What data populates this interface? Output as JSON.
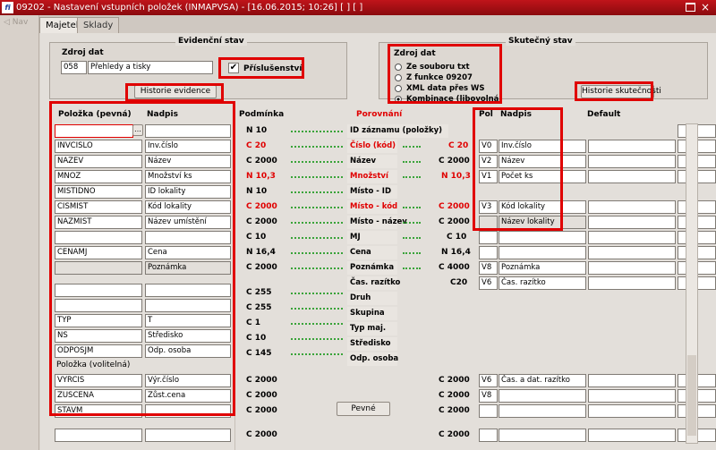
{
  "window": {
    "icon_text": "fi",
    "title": "09202 - Nastavení vstupních položek (INMAPVSA) - [16.06.2015; 10:26] [ ] [ ]",
    "close_glyph": "×"
  },
  "nav": {
    "label": "◁ Nav"
  },
  "tabs": [
    "Majetek",
    "Sklady"
  ],
  "evidencni": {
    "title": "Evidenční stav",
    "zdroj_label": "Zdroj dat",
    "zdroj_code": "058",
    "zdroj_name": "Přehledy a tisky",
    "prislusenstvi_check": "✔",
    "prislusenstvi_label": "Příslušenství",
    "historie_btn": "Historie evidence"
  },
  "skutecny": {
    "title": "Skutečný stav",
    "zdroj_label": "Zdroj dat",
    "radio_options": [
      "Ze souboru txt",
      "Z funkce 09207",
      "XML data přes WS",
      "Kombinace (libovolná)"
    ],
    "historie_btn": "Historie skutečnosti"
  },
  "headers": {
    "polozka": "Položka  (pevná)",
    "nadpis": "Nadpis",
    "podminka": "Podmínka",
    "porovnani": "Porovnání",
    "pol": "Pol",
    "nadpis_r": "Nadpis",
    "default": "Default",
    "polozka_volitelna": "Položka   (volitelná)"
  },
  "ellipsis": "…",
  "button_pevne": "Pevné",
  "rows": [
    {
      "item": "",
      "title": "",
      "cond": "N 10",
      "cmp": "ID záznamu (položky)",
      "rcond": "",
      "pol": "",
      "rtitle": ""
    },
    {
      "item": "INVCISLO",
      "title": "Inv.číslo",
      "cond": "C 20",
      "cmp": "Číslo (kód)",
      "rcond": "C 20",
      "pol": "V0",
      "rtitle": "Inv.číslo"
    },
    {
      "item": "NAZEV",
      "title": "Název",
      "cond": "C 2000",
      "cmp": "Název",
      "rcond": "C 2000",
      "pol": "V2",
      "rtitle": "Název"
    },
    {
      "item": "MNOZ",
      "title": "Množství ks",
      "cond": "N 10,3",
      "cmp": "Množství",
      "rcond": "N 10,3",
      "pol": "V1",
      "rtitle": "Počet ks"
    },
    {
      "item": "MISTIDNO",
      "title": "ID lokality",
      "cond": "N 10",
      "cmp": "Místo - ID",
      "rcond": "",
      "pol": "",
      "rtitle": ""
    },
    {
      "item": "CISMIST",
      "title": "Kód lokality",
      "cond": "C 2000",
      "cmp": "Místo - kód",
      "rcond": "C 2000",
      "pol": "V3",
      "rtitle": "Kód lokality"
    },
    {
      "item": "NAZMIST",
      "title": "Název umístění",
      "cond": "C 2000",
      "cmp": "Místo - název",
      "rcond": "C 2000",
      "pol": "",
      "rtitle": "Název lokality"
    },
    {
      "item": "",
      "title": "",
      "cond": "C 10",
      "cmp": "MJ",
      "rcond": "C 10",
      "pol": "",
      "rtitle": ""
    },
    {
      "item": "CENAMJ",
      "title": "Cena",
      "cond": "N 16,4",
      "cmp": "Cena",
      "rcond": "N 16,4",
      "pol": "",
      "rtitle": ""
    },
    {
      "item": "",
      "title": "Poznámka",
      "cond": "C 2000",
      "cmp": "Poznámka",
      "rcond": "C 4000",
      "pol": "V8",
      "rtitle": "Poznámka"
    },
    {
      "item": "",
      "title": "",
      "cond": "",
      "cmp": "Čas. razítko",
      "rcond": "C20",
      "pol": "V6",
      "rtitle": "Čas. razítko"
    },
    {
      "item": "",
      "title": "",
      "cond": "C 255",
      "cmp": "Druh",
      "rcond": "",
      "pol": "",
      "rtitle": ""
    },
    {
      "item": "",
      "title": "",
      "cond": "C 255",
      "cmp": "Skupina",
      "rcond": "",
      "pol": "",
      "rtitle": ""
    },
    {
      "item": "TYP",
      "title": "T",
      "cond": "C 1",
      "cmp": "Typ maj.",
      "rcond": "",
      "pol": "",
      "rtitle": ""
    },
    {
      "item": "NS",
      "title": "Středisko",
      "cond": "C 10",
      "cmp": "Středisko",
      "rcond": "",
      "pol": "",
      "rtitle": ""
    },
    {
      "item": "ODPOSJM",
      "title": "Odp. osoba",
      "cond": "C 145",
      "cmp": "Odp. osoba",
      "rcond": "",
      "pol": "",
      "rtitle": ""
    }
  ],
  "vol_rows": [
    {
      "item": "VYRCIS",
      "title": "Výr.číslo",
      "cond": "C 2000",
      "rcond": "C 2000",
      "pol": "V6",
      "rtitle": "Čas. a dat. razítko"
    },
    {
      "item": "ZUSCENA",
      "title": "Zůst.cena",
      "cond": "C 2000",
      "rcond": "C 2000",
      "pol": "V8",
      "rtitle": ""
    },
    {
      "item": "STAVM",
      "title": "",
      "cond": "C 2000",
      "rcond": "C 2000",
      "pol": "",
      "rtitle": ""
    },
    {
      "item": "",
      "title": "",
      "cond": "C 2000",
      "rcond": "C 2000",
      "pol": "",
      "rtitle": ""
    }
  ]
}
